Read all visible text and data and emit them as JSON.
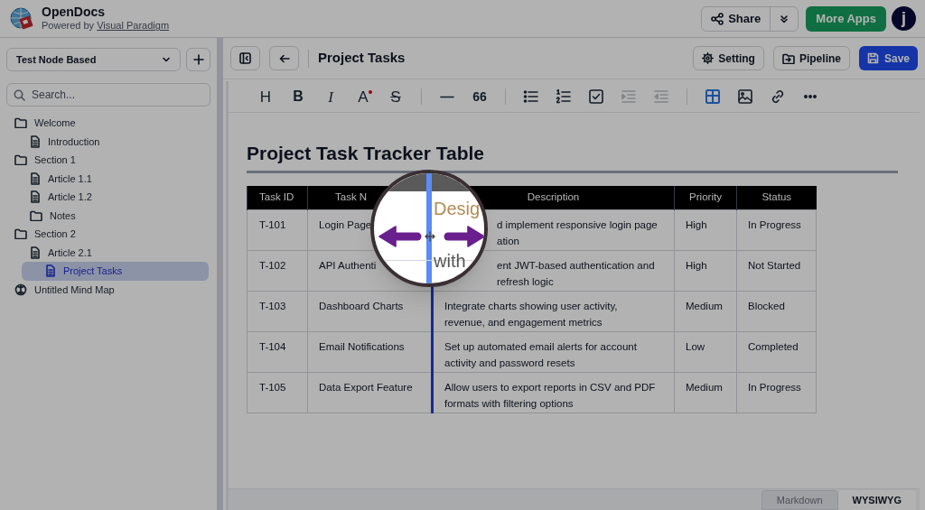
{
  "app": {
    "name": "OpenDocs",
    "tagline": "Powered by ",
    "tagline_link": "Visual Paradigm",
    "share": "Share",
    "more_apps": "More Apps",
    "avatar": "j"
  },
  "sidebar": {
    "space": "Test Node Based",
    "search": {
      "placeholder": "Search..."
    },
    "tree": [
      {
        "label": "Welcome",
        "kind": "folder",
        "selected": false,
        "children": [
          {
            "label": "Introduction",
            "kind": "doc",
            "selected": false
          }
        ]
      },
      {
        "label": "Section 1",
        "kind": "folder",
        "selected": false,
        "children": [
          {
            "label": "Article 1.1",
            "kind": "doc",
            "selected": false
          },
          {
            "label": "Article 1.2",
            "kind": "doc",
            "selected": false
          },
          {
            "label": "Notes",
            "kind": "folder",
            "selected": false
          }
        ]
      },
      {
        "label": "Section 2",
        "kind": "folder",
        "selected": false,
        "children": [
          {
            "label": "Article 2.1",
            "kind": "doc",
            "selected": false
          },
          {
            "label": "Project Tasks",
            "kind": "doc",
            "selected": true
          }
        ]
      },
      {
        "label": "Untitled Mind Map",
        "kind": "mindmap",
        "selected": false
      }
    ]
  },
  "document": {
    "title": "Project Tasks",
    "setting": "Setting",
    "pipeline": "Pipeline",
    "save": "Save"
  },
  "toolbar": {
    "groups": [
      [
        {
          "kind": "glyph",
          "label": "H",
          "active": false,
          "disabled": false
        },
        {
          "kind": "glyph",
          "label": "B",
          "active": false,
          "disabled": false
        },
        {
          "kind": "glyph",
          "label": "I",
          "active": false,
          "disabled": false
        },
        {
          "kind": "glyph",
          "label": "A",
          "active": false,
          "disabled": false
        },
        {
          "kind": "glyph",
          "label": "S",
          "active": false,
          "disabled": false
        }
      ],
      [
        {
          "kind": "rule",
          "active": false,
          "disabled": false
        },
        {
          "kind": "glyph",
          "label": "66",
          "active": false,
          "disabled": false
        }
      ],
      [
        {
          "kind": "bullets",
          "active": false,
          "disabled": false
        },
        {
          "kind": "numbers",
          "active": false,
          "disabled": false
        },
        {
          "kind": "task",
          "active": false,
          "disabled": false
        },
        {
          "kind": "indent",
          "active": false,
          "disabled": true
        },
        {
          "kind": "outdent",
          "active": false,
          "disabled": true
        }
      ],
      [
        {
          "kind": "table",
          "active": true,
          "disabled": false
        },
        {
          "kind": "image",
          "active": false,
          "disabled": false
        },
        {
          "kind": "link",
          "active": false,
          "disabled": false
        },
        {
          "kind": "more",
          "active": false,
          "disabled": false
        }
      ]
    ]
  },
  "content": {
    "heading": "Project Task Tracker Table",
    "table": {
      "columns": [
        "Task ID",
        "Task N",
        "Description",
        "Priority",
        "Status"
      ],
      "rows": [
        {
          "id": "T-101",
          "name": "Login Page",
          "description": [
            "d implement responsive login page",
            "ation"
          ],
          "priority": "High",
          "status": "In Progress"
        },
        {
          "id": "T-102",
          "name": "API Authenti",
          "description": [
            "ent JWT-based authentication and",
            "refresh logic"
          ],
          "priority": "High",
          "status": "Not Started"
        },
        {
          "id": "T-103",
          "name": "Dashboard Charts",
          "description": [
            "Integrate charts showing user activity,",
            "revenue, and engagement metrics"
          ],
          "priority": "Medium",
          "status": "Blocked"
        },
        {
          "id": "T-104",
          "name": "Email Notifications",
          "description": [
            "Set up automated email alerts for account",
            "activity and password resets"
          ],
          "priority": "Low",
          "status": "Completed"
        },
        {
          "id": "T-105",
          "name": "Data Export Feature",
          "description": [
            "Allow users to export reports in CSV and PDF",
            "formats with filtering options"
          ],
          "priority": "Medium",
          "status": "In Progress"
        }
      ]
    }
  },
  "magnifier": {
    "texts": [
      "Desig",
      "with"
    ]
  },
  "editor_modes": [
    {
      "label": "Markdown",
      "selected": false
    },
    {
      "label": "WYSIWYG",
      "selected": true
    }
  ]
}
